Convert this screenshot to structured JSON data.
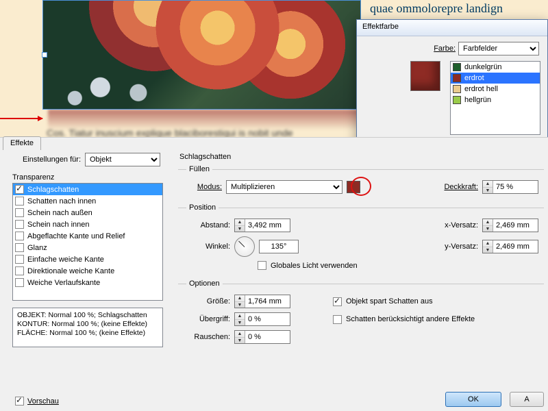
{
  "preview_text": "quae ommolorepre landign",
  "preview_blur": "Cos. Tiatur inuscium explique blaciborestiqui is nobit unde",
  "effects_dialog": {
    "tab": "Effekte",
    "settings_for_label": "Einstellungen für:",
    "settings_for_value": "Objekt",
    "transparenz_label": "Transparenz",
    "list": [
      {
        "label": "Schlagschatten",
        "checked": true,
        "selected": true
      },
      {
        "label": "Schatten nach innen",
        "checked": false
      },
      {
        "label": "Schein nach außen",
        "checked": false
      },
      {
        "label": "Schein nach innen",
        "checked": false
      },
      {
        "label": "Abgeflachte Kante und Relief",
        "checked": false
      },
      {
        "label": "Glanz",
        "checked": false
      },
      {
        "label": "Einfache weiche Kante",
        "checked": false
      },
      {
        "label": "Direktionale weiche Kante",
        "checked": false
      },
      {
        "label": "Weiche Verlaufskante",
        "checked": false
      }
    ],
    "summary": {
      "l1": "OBJEKT: Normal 100 %; Schlagschatten",
      "l2": "KONTUR: Normal 100 %; (keine Effekte)",
      "l3": "FLÄCHE: Normal 100 %; (keine Effekte)"
    },
    "preview_label": "Vorschau",
    "title": "Schlagschatten",
    "fill": {
      "legend": "Füllen",
      "mode_label": "Modus:",
      "mode": "Multiplizieren",
      "opacity_label": "Deckkraft:",
      "opacity": "75 %"
    },
    "position": {
      "legend": "Position",
      "dist_label": "Abstand:",
      "dist": "3,492 mm",
      "x_label": "x-Versatz:",
      "x": "2,469 mm",
      "angle_label": "Winkel:",
      "angle": "135°",
      "y_label": "y-Versatz:",
      "y": "2,469 mm",
      "global": "Globales Licht verwenden"
    },
    "options": {
      "legend": "Optionen",
      "size_label": "Größe:",
      "size": "1,764 mm",
      "obj_spares": "Objekt spart Schatten aus",
      "spread_label": "Übergriff:",
      "spread": "0 %",
      "shadow_other": "Schatten berücksichtigt andere Effekte",
      "noise_label": "Rauschen:",
      "noise": "0 %"
    },
    "ok": "OK",
    "other_btn": "A"
  },
  "color_dialog": {
    "title": "Effektfarbe",
    "farbe_label": "Farbe:",
    "farbe_value": "Farbfelder",
    "swatches": [
      {
        "name": "dunkelgrün",
        "color": "#1e5f2d"
      },
      {
        "name": "erdrot",
        "color": "#8e2b24",
        "selected": true
      },
      {
        "name": "erdrot hell",
        "color": "#eacb8e"
      },
      {
        "name": "hellgrün",
        "color": "#9acb4a"
      }
    ]
  }
}
